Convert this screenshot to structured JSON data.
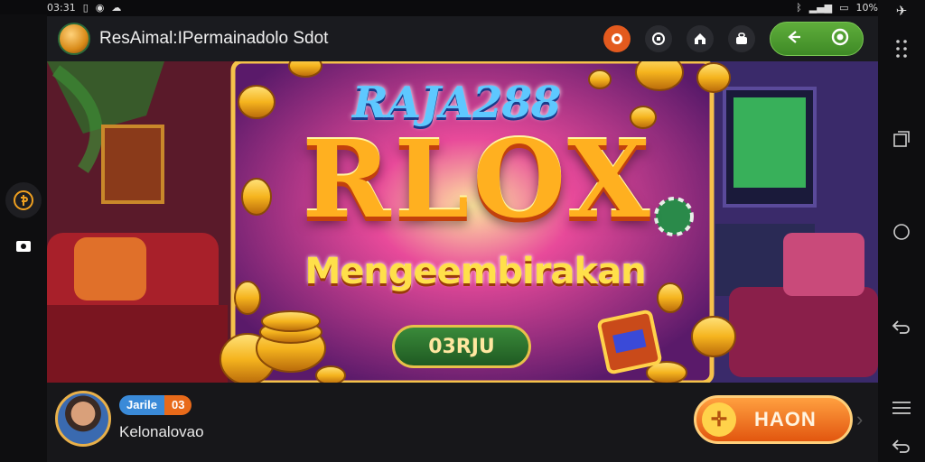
{
  "status": {
    "time": "03:31",
    "left_icons": [
      "sim-icon",
      "circle-icon",
      "cloud-icon"
    ],
    "right_icons": [
      "bluetooth-icon",
      "signal-icon",
      "battery-icon"
    ],
    "battery": "10%"
  },
  "header": {
    "title": "ResAimal:IPermainadolo Sdot",
    "icons": [
      "promo-icon",
      "coins-icon",
      "home-icon",
      "gift-icon"
    ],
    "pill_icons": [
      "share-icon",
      "power-icon"
    ]
  },
  "banner": {
    "brand": "RAJA288",
    "headline": "RLOX",
    "subheadline": "Mengeembirakan",
    "button_label": "03RJU"
  },
  "player": {
    "badge_name": "Jarile",
    "badge_level": "03",
    "username": "Kelonalovao"
  },
  "action": {
    "label": "HAON",
    "icon": "plus-icon"
  },
  "nav": {
    "left_items": [
      "coin-icon",
      "camera-icon"
    ],
    "right_items": [
      "menu-dots-icon",
      "recent-apps-icon",
      "home-circle-icon",
      "back-icon",
      "list-icon",
      "return-icon"
    ]
  },
  "colors": {
    "accent": "#e2560f",
    "green": "#4a9a30",
    "gold": "#f5b41e"
  }
}
